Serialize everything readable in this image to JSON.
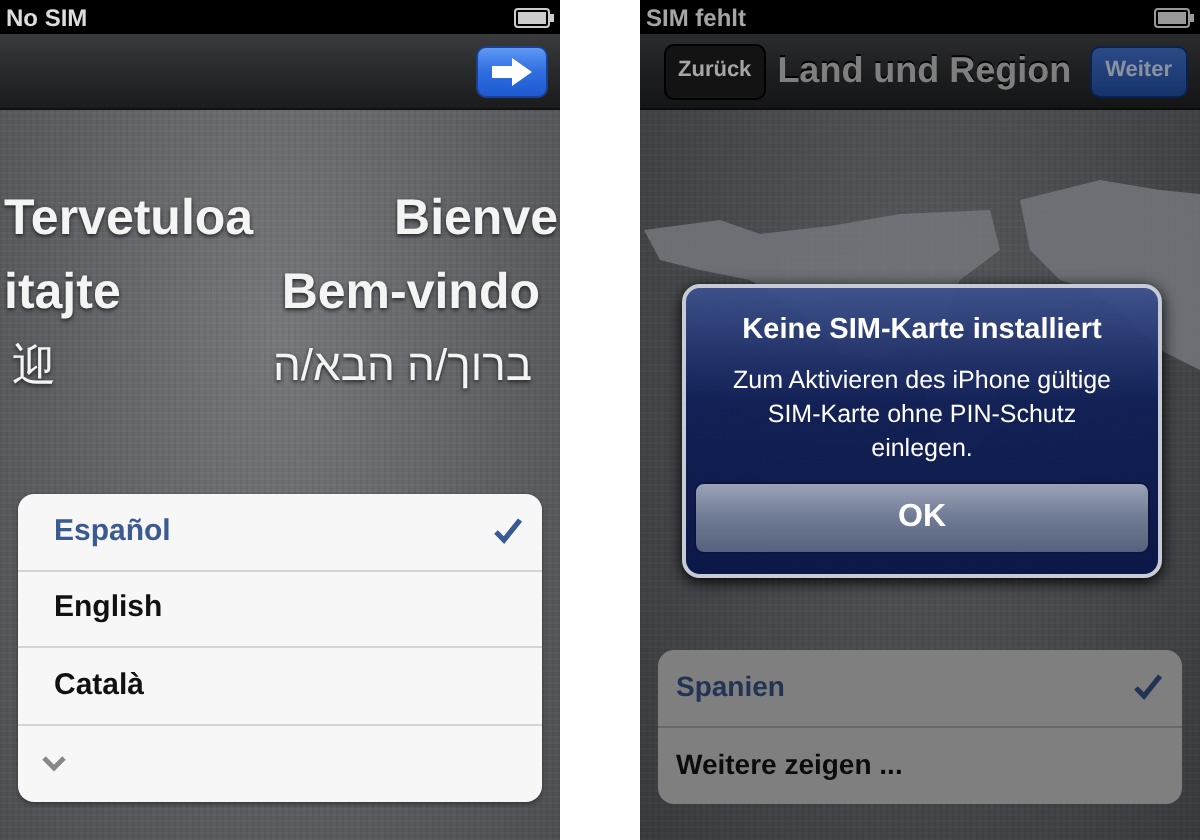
{
  "left_screen": {
    "status_bar": {
      "carrier": "No SIM"
    },
    "welcome_rows": [
      {
        "left": "Tervetuloa",
        "right": "Bienve"
      },
      {
        "left": "itajte",
        "right": "Bem-vindo"
      },
      {
        "left": "迎",
        "right": "ברוך/ה הבא/ה"
      }
    ],
    "languages": [
      {
        "kind": "item",
        "label": "Español",
        "selected": true
      },
      {
        "kind": "item",
        "label": "English",
        "selected": false
      },
      {
        "kind": "item",
        "label": "Català",
        "selected": false
      },
      {
        "kind": "more"
      }
    ]
  },
  "right_screen": {
    "status_bar": {
      "carrier": "SIM fehlt"
    },
    "nav_bar": {
      "back": "Zurück",
      "title": "Land und Region",
      "next": "Weiter"
    },
    "alert": {
      "title": "Keine SIM-Karte installiert",
      "message": "Zum Aktivieren des iPhone gültige SIM-Karte ohne PIN-Schutz einlegen.",
      "button": "OK"
    },
    "countries": [
      {
        "kind": "item",
        "label": "Spanien",
        "selected": true
      },
      {
        "kind": "item",
        "label": "Weitere zeigen ...",
        "selected": false
      }
    ]
  }
}
